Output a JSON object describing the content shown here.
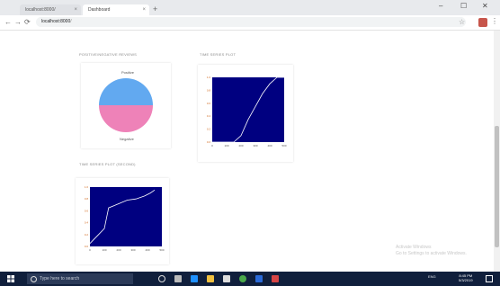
{
  "browser": {
    "tabs": [
      {
        "label": "localhost:8000/",
        "close": "×"
      },
      {
        "label": "Dashboard",
        "close": "×"
      }
    ],
    "new_tab": "+",
    "window_controls": {
      "minimize": "–",
      "maximize": "☐",
      "close": "✕"
    },
    "nav": {
      "back": "←",
      "forward": "→",
      "reload": "⟳"
    },
    "url_host": "localhost:8000",
    "url_path": "/",
    "star": "☆",
    "menu": "⋮"
  },
  "charts": {
    "pie_title": "POSITIVE/NEGATIVE REVIEWS",
    "line1_title": "TIME SERIES PLOT",
    "line2_title": "TIME SERIES PLOT (SECOND)"
  },
  "chart_data": [
    {
      "type": "pie",
      "labels": [
        "Positive",
        "Negative"
      ],
      "values": [
        50,
        50
      ],
      "colors": [
        "#62a9f0",
        "#ee82b8"
      ]
    },
    {
      "type": "line",
      "x": [
        0,
        150,
        200,
        250,
        300,
        350,
        400,
        450,
        500
      ],
      "values": [
        0,
        0,
        0.1,
        0.35,
        0.55,
        0.75,
        0.9,
        1.0,
        1.0
      ],
      "xlim": [
        0,
        500
      ],
      "ylim": [
        0,
        1
      ],
      "xticks": [
        "0",
        "100",
        "200",
        "300",
        "400",
        "500"
      ],
      "yticks": [
        "0.0",
        "0.2",
        "0.4",
        "0.6",
        "0.8",
        "1.0"
      ],
      "xlabel": "",
      "ylabel": "",
      "color": "#ffffff",
      "background": "#000080"
    },
    {
      "type": "line",
      "x": [
        0,
        60,
        100,
        130,
        200,
        260,
        320,
        380,
        420,
        450
      ],
      "values": [
        0.05,
        0.2,
        0.3,
        0.65,
        0.72,
        0.78,
        0.8,
        0.85,
        0.9,
        0.95
      ],
      "xlim": [
        0,
        500
      ],
      "ylim": [
        0,
        1
      ],
      "xticks": [
        "0",
        "100",
        "200",
        "300",
        "400",
        "500"
      ],
      "yticks": [
        "0.0",
        "0.2",
        "0.4",
        "0.6",
        "0.8",
        "1.0"
      ],
      "xlabel": "",
      "ylabel": "",
      "color": "#ffffff",
      "background": "#000080"
    }
  ],
  "watermark": {
    "line1": "Activate Windows",
    "line2": "Go to Settings to activate Windows."
  },
  "taskbar": {
    "search_placeholder": "Type here to search",
    "tray_text": "ENG",
    "time": "8:45 PM",
    "date": "5/3/2019"
  }
}
